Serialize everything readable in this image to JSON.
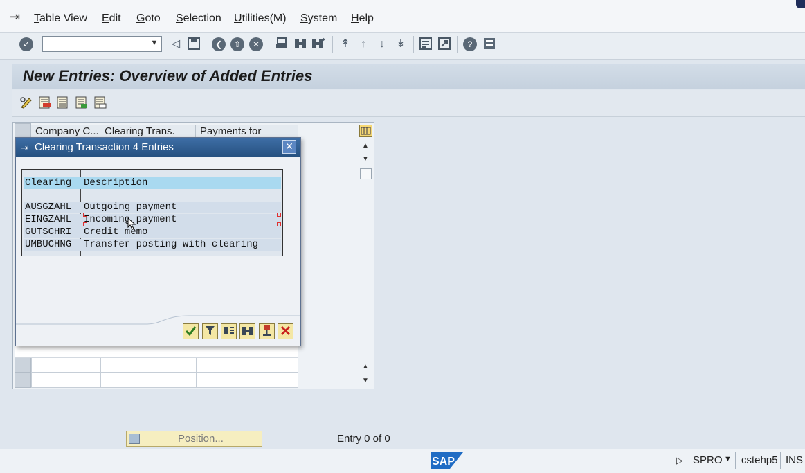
{
  "menu": {
    "items": [
      "Table View",
      "Edit",
      "Goto",
      "Selection",
      "Utilities(M)",
      "System",
      "Help"
    ]
  },
  "toolbar": {
    "command_field_value": "",
    "icons": [
      "enter-icon",
      "back-arrow-icon",
      "save-icon",
      "back-icon",
      "exit-icon",
      "cancel-icon",
      "print-icon",
      "find-icon",
      "find-next-icon",
      "first-page-icon",
      "previous-page-icon",
      "next-page-icon",
      "last-page-icon",
      "create-session-icon",
      "shortcut-icon",
      "help-icon",
      "customize-layout-icon"
    ]
  },
  "page": {
    "title": "New Entries: Overview of Added Entries"
  },
  "table": {
    "columns": [
      "Company C...",
      "Clearing Trans.",
      "Payments for"
    ],
    "rows_visible": 2
  },
  "dialog": {
    "title": "Clearing Transaction 4 Entries",
    "headers": {
      "code": "Clearing",
      "description": "Description"
    },
    "entries": [
      {
        "code": "AUSGZAHL",
        "description": "Outgoing payment"
      },
      {
        "code": "EINGZAHL",
        "description": "Incoming payment"
      },
      {
        "code": "GUTSCHRI",
        "description": "Credit memo"
      },
      {
        "code": "UMBUCHNG",
        "description": "Transfer posting with clearing"
      }
    ],
    "buttons": [
      "confirm-icon",
      "filter-icon",
      "sort-icon",
      "search-icon",
      "download-icon",
      "cancel-icon"
    ]
  },
  "footer": {
    "position_label": "Position...",
    "entry_info": "Entry 0 of 0"
  },
  "status": {
    "logo_text": "SAP",
    "transaction": "SPRO",
    "server": "cstehp5",
    "mode": "INS"
  }
}
